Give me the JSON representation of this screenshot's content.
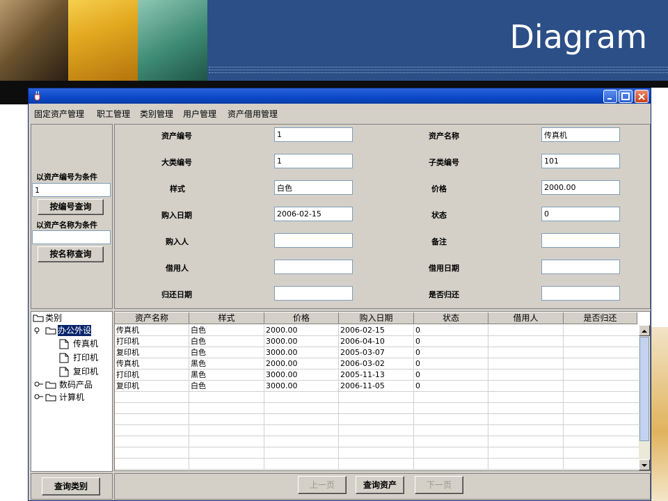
{
  "slide": {
    "title": "Diagram"
  },
  "window": {
    "controls": [
      "minimize-icon",
      "maximize-icon",
      "close-icon"
    ]
  },
  "menu": [
    "固定资产管理",
    "职工管理",
    "类别管理",
    "用户管理",
    "资产借用管理"
  ],
  "search": {
    "by_id_label": "以资产编号为条件",
    "by_id_value": "1",
    "by_id_button": "按编号查询",
    "by_name_label": "以资产名称为条件",
    "by_name_value": "",
    "by_name_button": "按名称查询"
  },
  "form": {
    "asset_id_label": "资产编号",
    "asset_id": "1",
    "asset_name_label": "资产名称",
    "asset_name": "传真机",
    "major_id_label": "大类编号",
    "major_id": "1",
    "sub_id_label": "子类编号",
    "sub_id": "101",
    "style_label": "样式",
    "style": "白色",
    "price_label": "价格",
    "price": "2000.00",
    "buy_date_label": "购入日期",
    "buy_date": "2006-02-15",
    "status_label": "状态",
    "status": "0",
    "buyer_label": "购入人",
    "buyer": "",
    "remark_label": "备注",
    "remark": "",
    "borrower_label": "借用人",
    "borrower": "",
    "borrow_date_label": "借用日期",
    "borrow_date": "",
    "return_date_label": "归还日期",
    "return_date": "",
    "returned_label": "是否归还",
    "returned": ""
  },
  "tree": {
    "root": "类别",
    "groups": [
      {
        "label": "办公外设",
        "expanded": true,
        "children": [
          "传真机",
          "打印机",
          "复印机"
        ]
      },
      {
        "label": "数码产品",
        "expanded": false
      },
      {
        "label": "计算机",
        "expanded": false
      }
    ]
  },
  "table": {
    "headers": [
      "资产名称",
      "样式",
      "价格",
      "购入日期",
      "状态",
      "借用人",
      "是否归还"
    ],
    "rows": [
      [
        "传真机",
        "白色",
        "2000.00",
        "2006-02-15",
        "0",
        "",
        ""
      ],
      [
        "打印机",
        "白色",
        "3000.00",
        "2006-04-10",
        "0",
        "",
        ""
      ],
      [
        "复印机",
        "白色",
        "3000.00",
        "2005-03-07",
        "0",
        "",
        ""
      ],
      [
        "传真机",
        "黑色",
        "2000.00",
        "2006-03-02",
        "0",
        "",
        ""
      ],
      [
        "打印机",
        "黑色",
        "3000.00",
        "2005-11-13",
        "0",
        "",
        ""
      ],
      [
        "复印机",
        "白色",
        "3000.00",
        "2006-11-05",
        "0",
        "",
        ""
      ]
    ],
    "empty_rows": 7
  },
  "buttons": {
    "query_category": "查询类别",
    "prev_page": "上一页",
    "query_assets": "查询资产",
    "next_page": "下一页"
  },
  "colors": {
    "banner": "#2b4f86",
    "titlebar": "#0a48c8",
    "panel": "#d4d0c8",
    "selection": "#0a246a"
  }
}
